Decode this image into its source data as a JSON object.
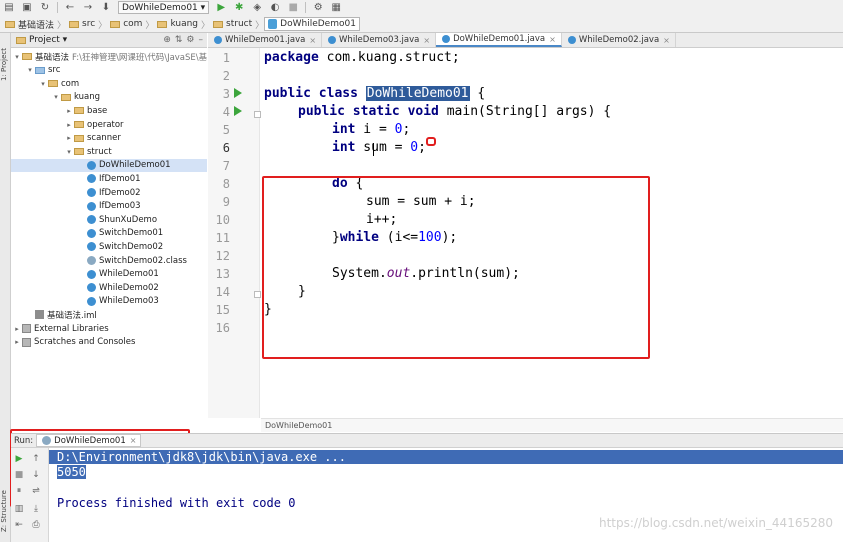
{
  "breadcrumbs": [
    "基础语法",
    "src",
    "com",
    "kuang",
    "struct",
    "DoWhileDemo01"
  ],
  "run_config": "DoWhileDemo01",
  "toolwindow_tabs": {
    "project": "1: Project",
    "structure": "Z: Structure"
  },
  "project_panel": {
    "title": "Project",
    "tree": [
      {
        "label": "基础语法",
        "sub": "F:\\狂神管理\\网课班\\代码\\JavaSE\\基础",
        "type": "module",
        "depth": 0,
        "open": true
      },
      {
        "label": "src",
        "type": "folder-blue",
        "depth": 1,
        "open": true
      },
      {
        "label": "com",
        "type": "folder",
        "depth": 2,
        "open": true
      },
      {
        "label": "kuang",
        "type": "folder",
        "depth": 3,
        "open": true
      },
      {
        "label": "base",
        "type": "folder",
        "depth": 4,
        "open": false
      },
      {
        "label": "operator",
        "type": "folder",
        "depth": 4,
        "open": false
      },
      {
        "label": "scanner",
        "type": "folder",
        "depth": 4,
        "open": false
      },
      {
        "label": "struct",
        "type": "folder",
        "depth": 4,
        "open": true
      },
      {
        "label": "DoWhileDemo01",
        "type": "class",
        "depth": 5,
        "selected": true
      },
      {
        "label": "IfDemo01",
        "type": "class",
        "depth": 5
      },
      {
        "label": "IfDemo02",
        "type": "class",
        "depth": 5
      },
      {
        "label": "IfDemo03",
        "type": "class",
        "depth": 5
      },
      {
        "label": "ShunXuDemo",
        "type": "class",
        "depth": 5
      },
      {
        "label": "SwitchDemo01",
        "type": "class",
        "depth": 5
      },
      {
        "label": "SwitchDemo02",
        "type": "class",
        "depth": 5
      },
      {
        "label": "SwitchDemo02.class",
        "type": "class-file",
        "depth": 5
      },
      {
        "label": "WhileDemo01",
        "type": "class",
        "depth": 5
      },
      {
        "label": "WhileDemo02",
        "type": "class",
        "depth": 5
      },
      {
        "label": "WhileDemo03",
        "type": "class",
        "depth": 5
      },
      {
        "label": "基础语法.iml",
        "type": "iml",
        "depth": 1
      },
      {
        "label": "External Libraries",
        "type": "lib",
        "depth": 0,
        "open": false
      },
      {
        "label": "Scratches and Consoles",
        "type": "lib",
        "depth": 0,
        "open": false
      }
    ]
  },
  "editor_tabs": [
    {
      "label": "WhileDemo01.java",
      "active": false
    },
    {
      "label": "WhileDemo03.java",
      "active": false
    },
    {
      "label": "DoWhileDemo01.java",
      "active": true
    },
    {
      "label": "WhileDemo02.java",
      "active": false
    }
  ],
  "code": {
    "line_numbers": [
      "1",
      "2",
      "3",
      "4",
      "5",
      "6",
      "7",
      "8",
      "9",
      "10",
      "11",
      "12",
      "13",
      "14",
      "15",
      "16"
    ],
    "l1_kw": "package",
    "l1_rest": " com.kuang.struct;",
    "l3_kw1": "public",
    "l3_kw2": "class",
    "l3_name": "DoWhileDemo01",
    "l3_rest": " {",
    "l4_kw": "public static void",
    "l4_rest": " main(String[] args) {",
    "l5_kw": "int",
    "l5_mid": " i = ",
    "l5_num": "0",
    "l5_end": ";",
    "l6_kw": "int",
    "l6_mid": " sum = ",
    "l6_num": "0",
    "l6_end": ";",
    "l8_kw": "do",
    "l8_rest": " {",
    "l9": "sum = sum + i;",
    "l10": "i++;",
    "l11_a": "}",
    "l11_kw": "while",
    "l11_b": " (i<=",
    "l11_num": "100",
    "l11_c": ");",
    "l13_a": "System.",
    "l13_fld": "out",
    "l13_b": ".println(sum);",
    "l14": "}",
    "l15": "}"
  },
  "editor_breadcrumb": "DoWhileDemo01",
  "run_panel": {
    "label": "Run:",
    "tab": "DoWhileDemo01",
    "lines": [
      "D:\\Environment\\jdk8\\jdk\\bin\\java.exe ...",
      "5050",
      "",
      "Process finished with exit code 0"
    ]
  },
  "watermark": "https://blog.csdn.net/weixin_44165280",
  "colors": {
    "keyword": "#000080",
    "number": "#0000ff",
    "annotation_red": "#e11e1e",
    "selection": "#2f5b9a"
  }
}
